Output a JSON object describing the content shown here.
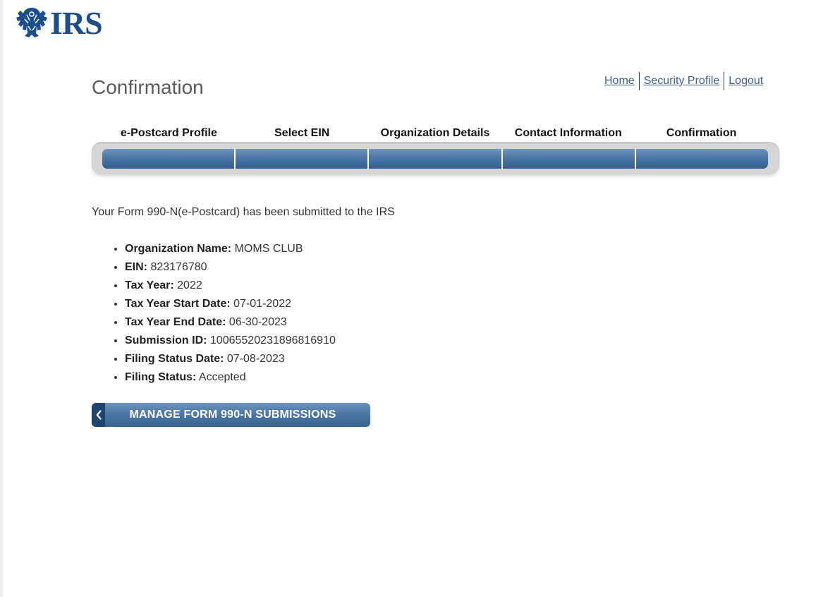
{
  "header": {
    "logo_text": "IRS",
    "links": [
      {
        "label": "Home"
      },
      {
        "label": "Security Profile"
      },
      {
        "label": "Logout"
      }
    ]
  },
  "page": {
    "title": "Confirmation"
  },
  "progress": {
    "steps": [
      {
        "label": "e-Postcard Profile"
      },
      {
        "label": "Select EIN"
      },
      {
        "label": "Organization Details"
      },
      {
        "label": "Contact Information"
      },
      {
        "label": "Confirmation"
      }
    ]
  },
  "confirmation": {
    "message": "Your Form 990-N(e-Postcard) has been submitted to the IRS",
    "details": [
      {
        "label": "Organization Name:",
        "value": "MOMS CLUB"
      },
      {
        "label": "EIN:",
        "value": "823176780"
      },
      {
        "label": "Tax Year:",
        "value": "2022"
      },
      {
        "label": "Tax Year Start Date:",
        "value": "07-01-2022"
      },
      {
        "label": "Tax Year End Date:",
        "value": "06-30-2023"
      },
      {
        "label": "Submission ID:",
        "value": "10065520231896816910"
      },
      {
        "label": "Filing Status Date:",
        "value": "07-08-2023"
      },
      {
        "label": "Filing Status:",
        "value": "Accepted"
      }
    ]
  },
  "actions": {
    "manage_label": "MANAGE FORM 990-N SUBMISSIONS"
  },
  "colors": {
    "brand": "#1a4f8b",
    "link": "#3d5e8f",
    "progress_bar": "#4c76a4",
    "button": "#4a74a1"
  },
  "icons": {
    "logo": "eagle-icon",
    "back": "chevron-left-icon"
  }
}
